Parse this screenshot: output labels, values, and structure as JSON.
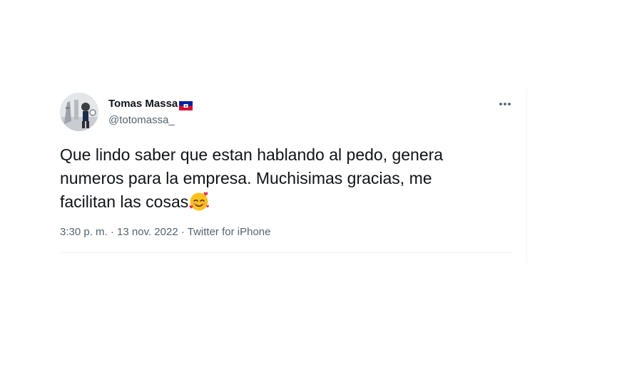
{
  "tweet": {
    "display_name": "Tomas Massa",
    "handle": "@totomassa_",
    "text_line1": "Que lindo saber que estan hablando al pedo, genera",
    "text_line2": "numeros para la empresa. Muchisimas gracias, me",
    "text_line3": "facilitan las cosas",
    "time": "3:30 p. m.",
    "separator": " · ",
    "date": "13 nov. 2022",
    "source": "Twitter for iPhone",
    "more_label": "···"
  },
  "icons": {
    "flag": "haiti-flag-icon",
    "emoji": "smiling-face-with-hearts-icon",
    "more": "more-options-icon",
    "avatar": "profile-photo"
  },
  "colors": {
    "text_primary": "#0f1419",
    "text_secondary": "#536471",
    "border": "#eff3f4",
    "flag_blue": "#00209f",
    "flag_red": "#d21034"
  }
}
